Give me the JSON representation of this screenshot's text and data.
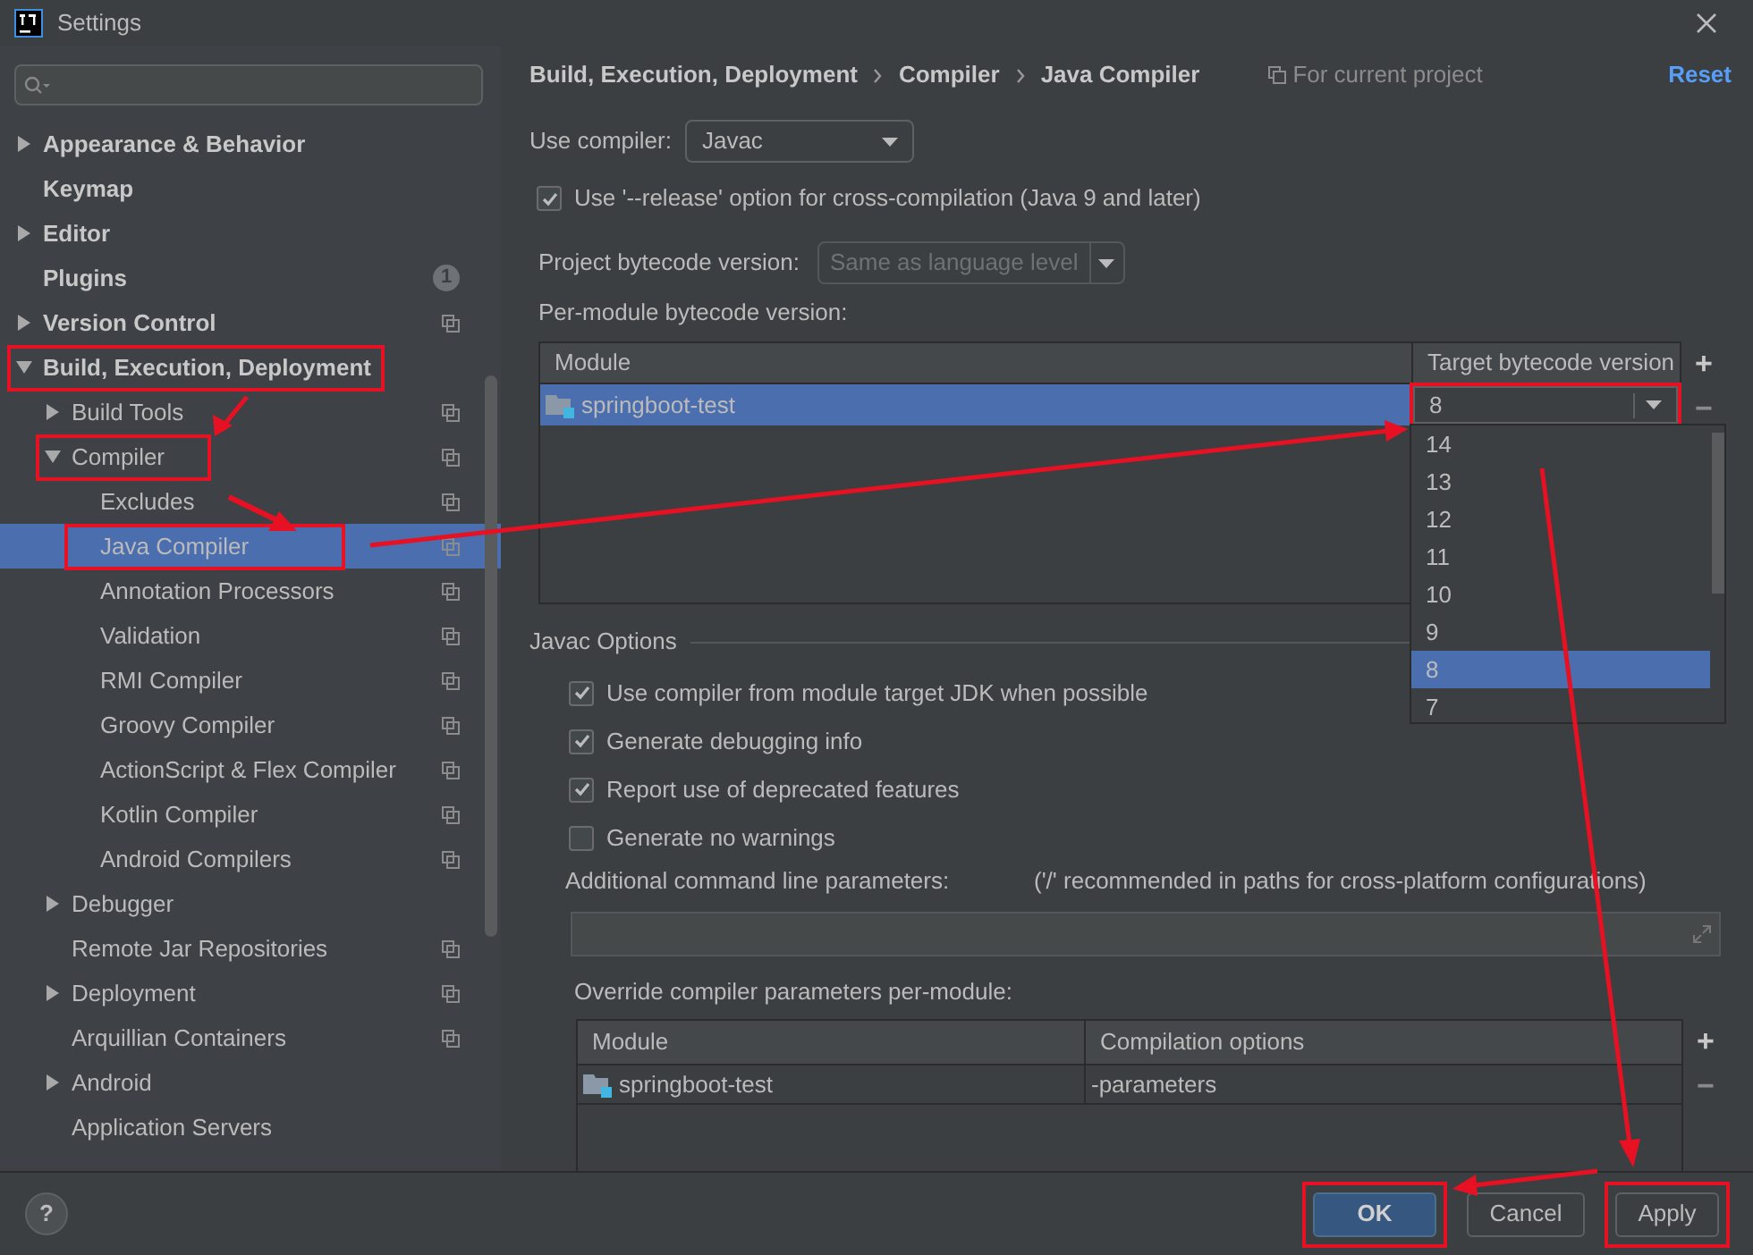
{
  "window": {
    "title": "Settings"
  },
  "sidebar": {
    "items": [
      {
        "label": "Appearance & Behavior",
        "expanded": false,
        "selected": false,
        "project_icon": false,
        "highlighted": false
      },
      {
        "label": "Keymap",
        "selected": false,
        "project_icon": false,
        "highlighted": false
      },
      {
        "label": "Editor",
        "expanded": false,
        "selected": false,
        "project_icon": false,
        "highlighted": false
      },
      {
        "label": "Plugins",
        "selected": false,
        "project_icon": false,
        "highlighted": false,
        "badge": "1"
      },
      {
        "label": "Version Control",
        "expanded": false,
        "selected": false,
        "project_icon": true,
        "highlighted": false
      },
      {
        "label": "Build, Execution, Deployment",
        "expanded": true,
        "selected": false,
        "project_icon": false,
        "highlighted": true,
        "children": [
          {
            "label": "Build Tools",
            "expanded": false,
            "selected": false,
            "project_icon": true,
            "highlighted": false
          },
          {
            "label": "Compiler",
            "expanded": true,
            "selected": false,
            "project_icon": true,
            "highlighted": true,
            "children": [
              {
                "label": "Excludes",
                "selected": false,
                "project_icon": true,
                "highlighted": false
              },
              {
                "label": "Java Compiler",
                "selected": true,
                "project_icon": true,
                "highlighted": true
              },
              {
                "label": "Annotation Processors",
                "selected": false,
                "project_icon": true,
                "highlighted": false
              },
              {
                "label": "Validation",
                "selected": false,
                "project_icon": true,
                "highlighted": false
              },
              {
                "label": "RMI Compiler",
                "selected": false,
                "project_icon": true,
                "highlighted": false
              },
              {
                "label": "Groovy Compiler",
                "selected": false,
                "project_icon": true,
                "highlighted": false
              },
              {
                "label": "ActionScript & Flex Compiler",
                "selected": false,
                "project_icon": true,
                "highlighted": false
              },
              {
                "label": "Kotlin Compiler",
                "selected": false,
                "project_icon": true,
                "highlighted": false
              },
              {
                "label": "Android Compilers",
                "selected": false,
                "project_icon": true,
                "highlighted": false
              }
            ]
          },
          {
            "label": "Debugger",
            "expanded": false,
            "selected": false,
            "project_icon": false,
            "highlighted": false
          },
          {
            "label": "Remote Jar Repositories",
            "selected": false,
            "project_icon": true,
            "highlighted": false
          },
          {
            "label": "Deployment",
            "expanded": false,
            "selected": false,
            "project_icon": true,
            "highlighted": false
          },
          {
            "label": "Arquillian Containers",
            "selected": false,
            "project_icon": true,
            "highlighted": false
          },
          {
            "label": "Android",
            "expanded": false,
            "selected": false,
            "project_icon": false,
            "highlighted": false
          },
          {
            "label": "Application Servers",
            "selected": false,
            "project_icon": false,
            "highlighted": false
          }
        ]
      }
    ]
  },
  "breadcrumb": [
    "Build, Execution, Deployment",
    "Compiler",
    "Java Compiler"
  ],
  "scope": "For current project",
  "reset": "Reset",
  "use_compiler": {
    "label": "Use compiler:",
    "value": "Javac"
  },
  "release_option": {
    "label": "Use '--release' option for cross-compilation (Java 9 and later)",
    "checked": true
  },
  "project_bytecode": {
    "label": "Project bytecode version:",
    "placeholder": "Same as language level",
    "disabled": true
  },
  "per_module": {
    "label": "Per-module bytecode version:",
    "columns": [
      "Module",
      "Target bytecode version"
    ],
    "rows": [
      {
        "module": "springboot-test",
        "target": "8",
        "selected": true,
        "highlighted": true
      }
    ],
    "toolbar": [
      "+",
      "−"
    ],
    "popup": [
      {
        "label": "14",
        "selected": false
      },
      {
        "label": "13",
        "selected": false
      },
      {
        "label": "12",
        "selected": false
      },
      {
        "label": "11",
        "selected": false
      },
      {
        "label": "10",
        "selected": false
      },
      {
        "label": "9",
        "selected": false
      },
      {
        "label": "8",
        "selected": true
      },
      {
        "label": "7",
        "selected": false
      }
    ]
  },
  "javac": {
    "title": "Javac Options",
    "options": [
      {
        "label": "Use compiler from module target JDK when possible",
        "checked": true
      },
      {
        "label": "Generate debugging info",
        "checked": true
      },
      {
        "label": "Report use of deprecated features",
        "checked": true
      },
      {
        "label": "Generate no warnings",
        "checked": false
      }
    ],
    "params_label": "Additional command line parameters:",
    "params_hint": "('/' recommended in paths for cross-platform configurations)",
    "override_label": "Override compiler parameters per-module:",
    "columns": [
      "Module",
      "Compilation options"
    ],
    "rows": [
      {
        "module": "springboot-test",
        "options": "-parameters"
      }
    ],
    "toolbar": [
      "+",
      "−"
    ]
  },
  "help": "?",
  "buttons": [
    {
      "label": "OK",
      "kind": "primary",
      "highlighted": true
    },
    {
      "label": "Cancel",
      "kind": "normal",
      "highlighted": false
    },
    {
      "label": "Apply",
      "kind": "normal",
      "highlighted": true
    }
  ]
}
